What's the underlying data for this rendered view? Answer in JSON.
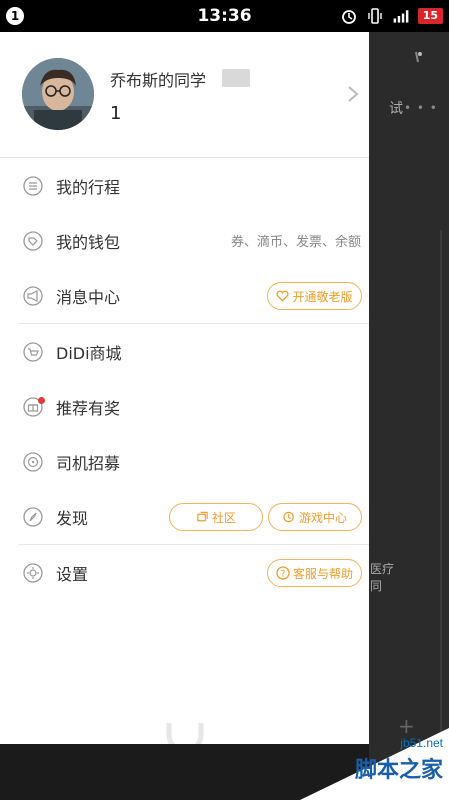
{
  "status_bar": {
    "notification_count": "1",
    "time": "13:36",
    "battery": "15"
  },
  "profile": {
    "name": "乔布斯的同学",
    "score": "1"
  },
  "menu": {
    "trips": "我的行程",
    "wallet": "我的钱包",
    "wallet_hint": "券、滴币、发票、余额",
    "messages": "消息中心",
    "elderly_mode": "开通敬老版",
    "mall": "DiDi商城",
    "referral": "推荐有奖",
    "driver_recruit": "司机招募",
    "discover": "发现",
    "community": "社区",
    "game_center": "游戏中心",
    "settings": "设置",
    "support": "客服与帮助"
  },
  "map_labels": {
    "a": "试",
    "b": "医疗",
    "c": "同"
  },
  "watermark": {
    "url": "jb51.net",
    "name": "脚本之家"
  }
}
